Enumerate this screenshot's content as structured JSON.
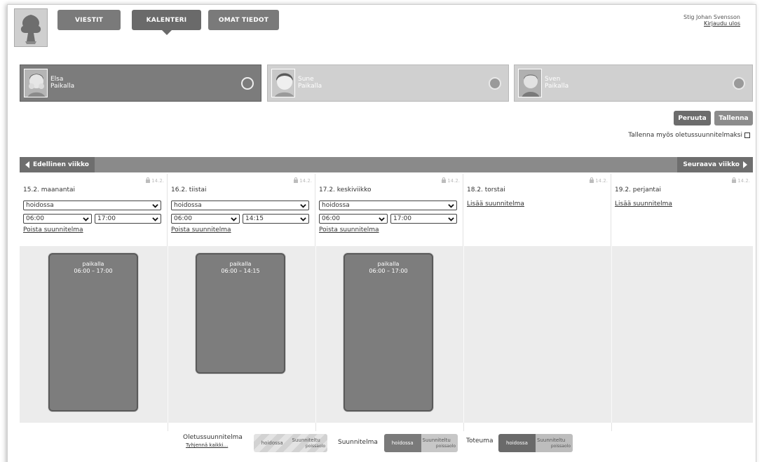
{
  "header": {
    "nav": [
      {
        "label": "VIESTIT",
        "active": false
      },
      {
        "label": "KALENTERI",
        "active": true
      },
      {
        "label": "OMAT TIEDOT",
        "active": false
      }
    ],
    "user_name": "Stig Johan Svensson",
    "logout_label": "Kirjaudu ulos"
  },
  "children": [
    {
      "name": "Elsa",
      "status": "Paikalla",
      "selected": true
    },
    {
      "name": "Sune",
      "status": "Paikalla",
      "selected": false
    },
    {
      "name": "Sven",
      "status": "Paikalla",
      "selected": false
    }
  ],
  "actions": {
    "cancel_label": "Peruuta",
    "save_label": "Tallenna",
    "save_default_label": "Tallenna myös oletussuunnitelmaksi"
  },
  "week_nav": {
    "prev_label": "Edellinen viikko",
    "next_label": "Seuraava viikko"
  },
  "days": [
    {
      "title": "15.2. maanantai",
      "lock_date": "14.2.",
      "status": "hoidossa",
      "start": "06:00",
      "end": "17:00",
      "link": "Poista suunnitelma",
      "block_label": "paikalla",
      "block_time": "06:00 – 17:00"
    },
    {
      "title": "16.2. tiistai",
      "lock_date": "14.2.",
      "status": "hoidossa",
      "start": "06:00",
      "end": "14:15",
      "link": "Poista suunnitelma",
      "block_label": "paikalla",
      "block_time": "06:00 – 14:15"
    },
    {
      "title": "17.2. keskiviikko",
      "lock_date": "14.2.",
      "status": "hoidossa",
      "start": "06:00",
      "end": "17:00",
      "link": "Poista suunnitelma",
      "block_label": "paikalla",
      "block_time": "06:00 – 17:00"
    },
    {
      "title": "18.2. torstai",
      "lock_date": "14.2.",
      "link": "Lisää suunnitelma"
    },
    {
      "title": "19.2. perjantai",
      "lock_date": "14.2.",
      "link": "Lisää suunnitelma"
    }
  ],
  "legend": {
    "default_plan": {
      "title": "Oletussuunnitelma",
      "clear_link": "Tyhjennä kaikki...",
      "seg1": "hoidossa",
      "seg2_line1": "Suunniteltu",
      "seg2_line2": "poissaolo"
    },
    "plan": {
      "title": "Suunnitelma",
      "seg1": "hoidossa",
      "seg2_line1": "Suunniteltu",
      "seg2_line2": "poissaolo"
    },
    "actual": {
      "title": "Toteuma",
      "seg1": "hoidossa",
      "seg2_line1": "Suunniteltu",
      "seg2_line2": "poissaolo"
    }
  },
  "colors": {
    "nav_button": "#7a7a7a",
    "active_card": "#7c7c7c",
    "inactive_card": "#d0d0d0",
    "block": "#7d7d7d",
    "schedule_bg": "#ececec"
  }
}
